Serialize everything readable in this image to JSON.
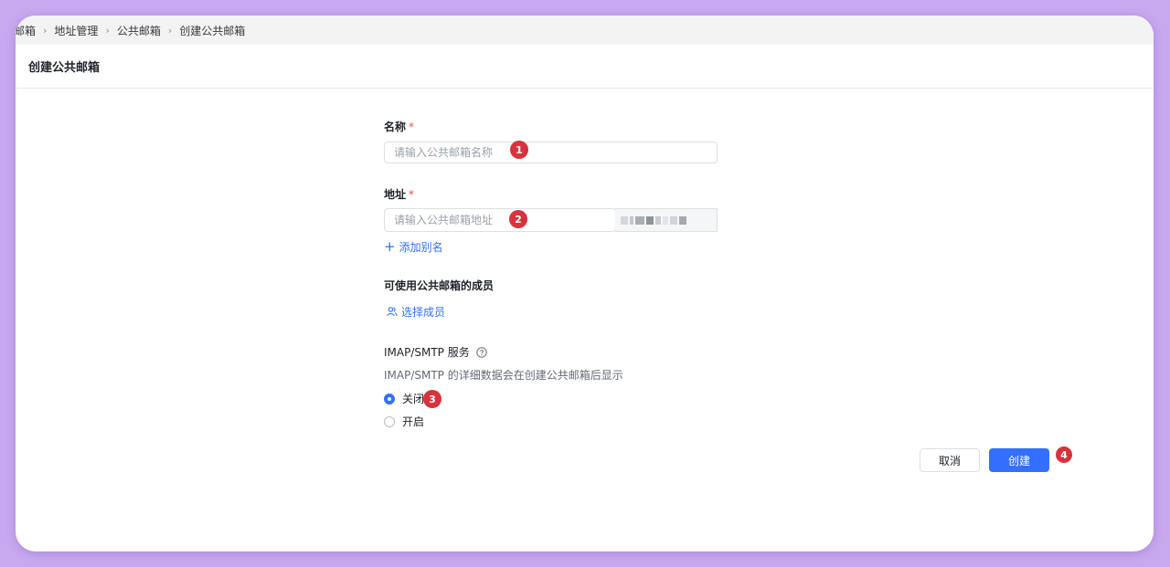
{
  "breadcrumb": {
    "items": [
      "邮箱",
      "地址管理",
      "公共邮箱",
      "创建公共邮箱"
    ]
  },
  "page": {
    "title": "创建公共邮箱"
  },
  "form": {
    "name": {
      "label": "名称",
      "required_mark": "*",
      "placeholder": "请输入公共邮箱名称",
      "value": ""
    },
    "address": {
      "label": "地址",
      "required_mark": "*",
      "placeholder": "请输入公共邮箱地址",
      "value": ""
    },
    "add_alias_label": "添加别名",
    "members": {
      "label": "可使用公共邮箱的成员",
      "select_label": "选择成员"
    },
    "imap": {
      "label": "IMAP/SMTP 服务",
      "description": "IMAP/SMTP 的详细数据会在创建公共邮箱后显示",
      "options": [
        {
          "label": "关闭",
          "selected": true
        },
        {
          "label": "开启",
          "selected": false
        }
      ]
    }
  },
  "actions": {
    "cancel_label": "取消",
    "create_label": "创建"
  },
  "markers": [
    "1",
    "2",
    "3",
    "4"
  ],
  "colors": {
    "accent": "#3370ff",
    "required": "#e34d4d",
    "marker": "#d8323c",
    "background": "#c8a9f0"
  }
}
